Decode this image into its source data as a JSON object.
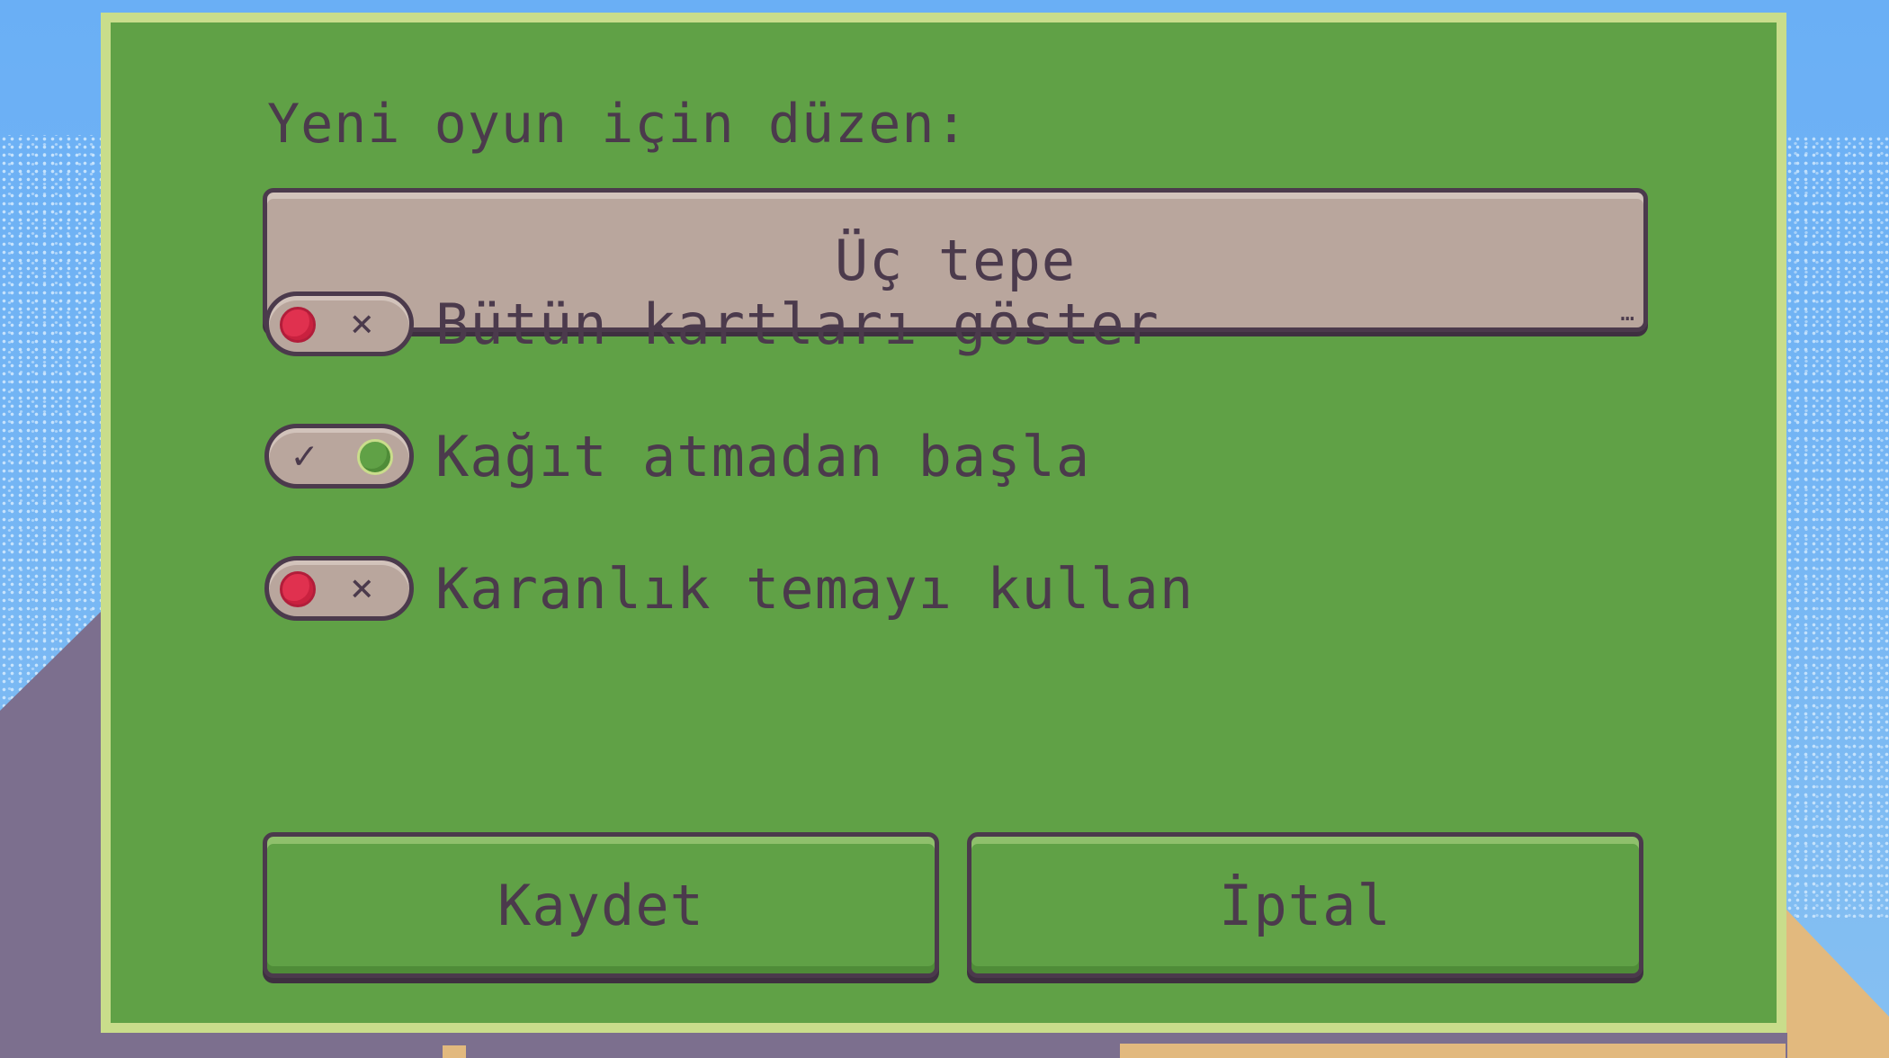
{
  "dialog": {
    "title": "Yeni oyun için düzen:",
    "preset": {
      "value": "Üç tepe",
      "more_icon": "…"
    },
    "options": [
      {
        "label": "Bütün kartları göster",
        "checked": false,
        "mark": "×"
      },
      {
        "label": "Kağıt atmadan başla",
        "checked": true,
        "mark": "✓"
      },
      {
        "label": "Karanlık temayı kullan",
        "checked": false,
        "mark": "×"
      }
    ],
    "buttons": {
      "save_label": "Kaydet",
      "cancel_label": "İptal"
    }
  },
  "colors": {
    "dialog_bg": "#60a146",
    "dialog_border": "#c9dd8b",
    "text": "#4b3a4c",
    "field_bg": "#b9a69d",
    "toggle_off": "#e0314f",
    "toggle_on": "#60a146",
    "sky": "#6aaff5",
    "hill": "#7c6f8e",
    "sand": "#e2b97e"
  }
}
